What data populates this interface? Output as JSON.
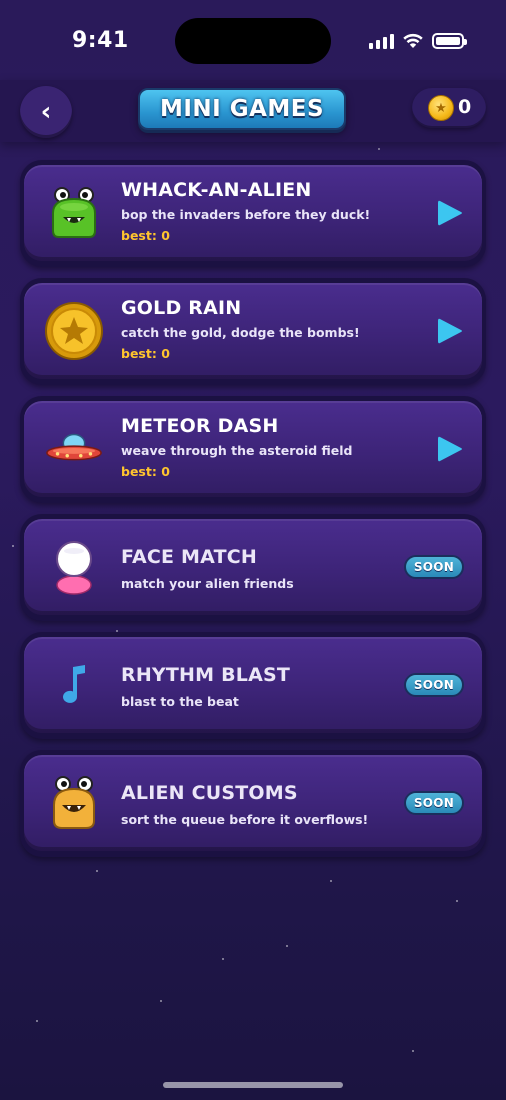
{
  "status_bar": {
    "time": "9:41",
    "icons": [
      "signal-icon",
      "wifi-icon",
      "battery-icon"
    ]
  },
  "header": {
    "back_icon": "chevron-left-icon",
    "back_glyph": "‹",
    "title": "MINI GAMES",
    "coin_icon": "coin-star-icon",
    "coin_count": "0"
  },
  "colors": {
    "accent_blue": "#2a95d0",
    "play_cyan": "#3cc6f0",
    "best_yellow": "#ffc52e",
    "card_purple": "#3d2478",
    "background": "#2a1a5a"
  },
  "games": [
    {
      "title": "WHACK-AN-ALIEN",
      "subtitle": "bop the invaders before they duck!",
      "best": "best: 0",
      "icon": "green-alien-icon",
      "status": "play"
    },
    {
      "title": "GOLD RAIN",
      "subtitle": "catch the gold, dodge the bombs!",
      "best": "best: 0",
      "icon": "gold-coin-icon",
      "status": "play"
    },
    {
      "title": "METEOR DASH",
      "subtitle": "weave through the asteroid field",
      "best": "best: 0",
      "icon": "ufo-icon",
      "status": "play"
    },
    {
      "title": "FACE MATCH",
      "subtitle": "match your alien friends",
      "icon": "alien-face-icon",
      "status": "soon",
      "badge": "SOON"
    },
    {
      "title": "RHYTHM BLAST",
      "subtitle": "blast to the beat",
      "icon": "music-note-icon",
      "status": "soon",
      "badge": "SOON"
    },
    {
      "title": "ALIEN CUSTOMS",
      "subtitle": "sort the queue before it overflows!",
      "icon": "orange-alien-icon",
      "status": "soon",
      "badge": "SOON"
    }
  ]
}
